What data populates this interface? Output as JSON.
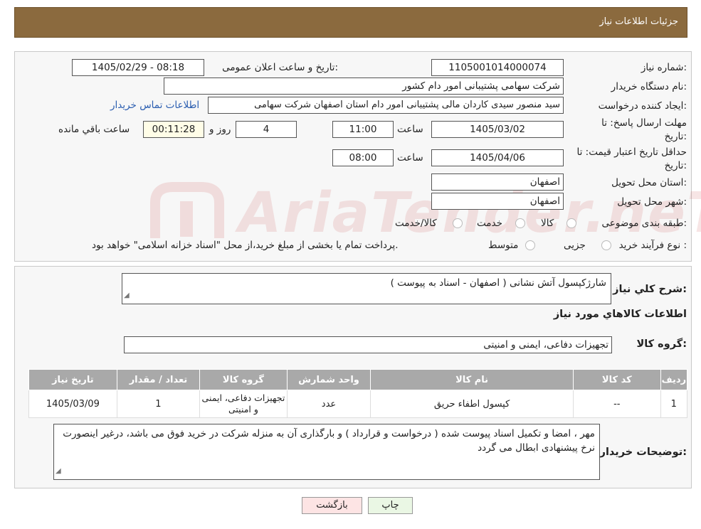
{
  "header": {
    "title": "جزئیات اطلاعات نیاز"
  },
  "form": {
    "need_number_label": "شماره نیاز:",
    "need_number": "1105001014000074",
    "announce_label": "تاریخ و ساعت اعلان عمومی:",
    "announce_value": "1405/02/29 - 08:18",
    "buyer_org_label": "نام دستگاه خریدار:",
    "buyer_org": "شرکت سهامی پشتیبانی امور دام کشور",
    "requester_label": "ایجاد کننده درخواست:",
    "requester": "سید منصور سیدی کاردان مالی پشتیبانی امور دام استان اصفهان شرکت سهامی",
    "contact_link": "اطلاعات تماس خریدار",
    "deadline_label_1": "مهلت ارسال پاسخ: تا",
    "deadline_label_2": "تاریخ:",
    "deadline_date": "1405/03/02",
    "time_label": "ساعت",
    "deadline_time": "11:00",
    "days_value": "4",
    "days_label": "روز و",
    "remaining_value": "00:11:28",
    "remaining_label": "ساعت باقي مانده",
    "validity_label_1": "حداقل تاریخ اعتبار قیمت: تا",
    "validity_label_2": "تاریخ:",
    "validity_date": "1405/04/06",
    "validity_time": "08:00",
    "province_label": "استان محل تحویل:",
    "province": "اصفهان",
    "city_label": "شهر محل تحویل:",
    "city": "اصفهان",
    "category_label": "طبقه بندی موضوعی:",
    "category_options": [
      "کالا",
      "خدمت",
      "کالا/خدمت"
    ],
    "process_label": "نوع فرآیند خرید :",
    "process_options": [
      "جزیی",
      "متوسط"
    ],
    "process_note": "پرداخت تمام یا بخشی از مبلغ خرید،از محل \"اسناد خزانه اسلامی\" خواهد بود."
  },
  "watermark": {
    "text": "AriaTender.neT"
  },
  "summary": {
    "label": "شرح کلي نياز:",
    "value": "شارژکپسول آتش نشانی ( اصفهان - اسناد به پیوست )"
  },
  "goods": {
    "section_title": "اطلاعات کالاهاي مورد نياز",
    "group_label": "گروه کالا:",
    "group_value": "تجهیزات دفاعی، ایمنی و امنیتی",
    "columns": [
      "ردیف",
      "کد کالا",
      "نام کالا",
      "واحد شمارش",
      "گروه کالا",
      "تعداد / مقدار",
      "تاریخ نیاز"
    ],
    "rows": [
      {
        "row": "1",
        "code": "--",
        "name": "کپسول اطفاء حریق",
        "unit": "عدد",
        "group": "تجهیزات دفاعی، ایمنی و امنیتی",
        "qty": "1",
        "date": "1405/03/09"
      }
    ]
  },
  "buyer_notes": {
    "label": "توضیحات خریدار:",
    "value": "مهر ، امضا و تکمیل اسناد پیوست شده ( درخواست و قرارداد ) و بارگذاری آن به منزله شرکت در خرید فوق می باشد، درغیر اینصورت نرخ پیشنهادی ابطال می گردد"
  },
  "buttons": {
    "print": "چاپ",
    "back": "بازگشت"
  },
  "colors": {
    "header": "#8b6a3e",
    "link": "#2a5db0",
    "print_btn": "#eaf7e4",
    "back_btn": "#fde4e4"
  }
}
